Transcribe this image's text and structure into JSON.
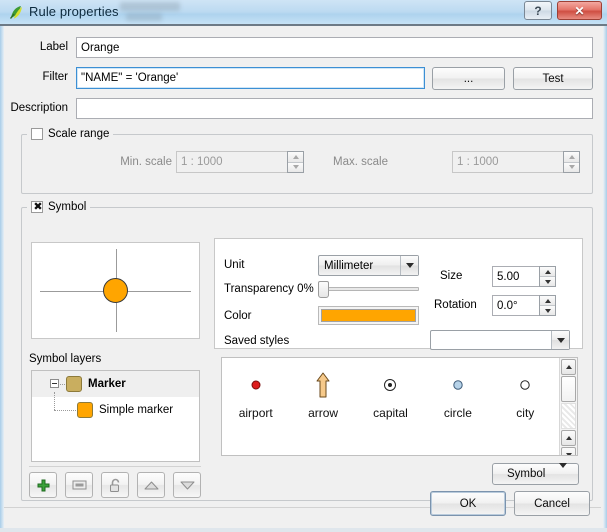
{
  "window": {
    "title": "Rule properties",
    "app_icon": "qgis-leaf-icon",
    "help_button": "?",
    "close_button": "✕"
  },
  "form": {
    "label_label": "Label",
    "label_value": "Orange",
    "filter_label": "Filter",
    "filter_value": "\"NAME\" = 'Orange'",
    "filter_builder_button": "...",
    "filter_test_button": "Test",
    "description_label": "Description",
    "description_value": ""
  },
  "scale_range": {
    "title": "Scale range",
    "checked": false,
    "min_label": "Min. scale",
    "min_value": "1 : 1000",
    "max_label": "Max. scale",
    "max_value": "1 : 1000"
  },
  "symbol": {
    "title": "Symbol",
    "checked": true,
    "preview_color": "#FFA500",
    "properties": {
      "unit_label": "Unit",
      "unit_value": "Millimeter",
      "transparency_label": "Transparency 0%",
      "transparency_percent": 0,
      "color_label": "Color",
      "color_value": "#FFA500",
      "saved_styles_label": "Saved styles",
      "saved_styles_value": "",
      "size_label": "Size",
      "size_value": "5.00",
      "rotation_label": "Rotation",
      "rotation_value": "0.0°"
    },
    "layers": {
      "title": "Symbol layers",
      "rows": [
        {
          "label": "Marker",
          "swatch": "#c9ae5f",
          "bold": true,
          "selected": true,
          "level": 0
        },
        {
          "label": "Simple marker",
          "swatch": "#FFA500",
          "bold": false,
          "selected": false,
          "level": 1
        }
      ],
      "buttons": [
        {
          "name": "add-symbol-layer-button",
          "icon": "plus-icon"
        },
        {
          "name": "remove-symbol-layer-button",
          "icon": "minus-icon"
        },
        {
          "name": "lock-layer-button",
          "icon": "lock-icon"
        },
        {
          "name": "move-layer-up-button",
          "icon": "triangle-up-icon"
        },
        {
          "name": "move-layer-down-button",
          "icon": "triangle-down-icon"
        }
      ]
    },
    "gallery": {
      "items": [
        {
          "label": "airport",
          "icon": "red-dot-icon"
        },
        {
          "label": "arrow",
          "icon": "arrow-up-icon"
        },
        {
          "label": "capital",
          "icon": "circle-dot-icon"
        },
        {
          "label": "circle",
          "icon": "blue-circle-icon"
        },
        {
          "label": "city",
          "icon": "hollow-circle-icon"
        }
      ],
      "partial_row": [
        {
          "icon": "light-green-triangle-icon"
        },
        {
          "icon": "arc-curve-icon"
        },
        {
          "icon": "red-dome-icon"
        },
        {
          "icon": "green-triangle-icon"
        },
        {
          "icon": "blue-bar-icon"
        }
      ],
      "symbol_menu_button": "Symbol"
    }
  },
  "footer": {
    "ok_label": "OK",
    "cancel_label": "Cancel"
  }
}
